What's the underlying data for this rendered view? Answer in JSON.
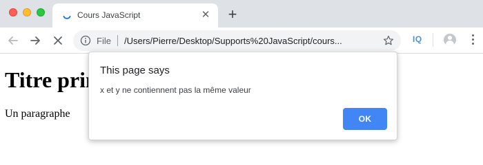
{
  "browser": {
    "tab": {
      "title": "Cours JavaScript",
      "close_glyph": "✕",
      "spinner_icon": "loading-spinner-icon"
    },
    "new_tab_glyph": "+",
    "toolbar": {
      "back_icon": "arrow-left-icon",
      "forward_icon": "arrow-right-icon",
      "stop_icon": "stop-loading-icon",
      "omnibox": {
        "scheme_label": "File",
        "url": "/Users/Pierre/Desktop/Supports%20JavaScript/cours...",
        "info_icon": "info-icon",
        "bookmark_icon": "star-icon"
      },
      "extension_label": "IQ",
      "extension_color": "#4a90d9"
    }
  },
  "page": {
    "heading": "Titre principal",
    "paragraph": "Un paragraphe"
  },
  "dialog": {
    "title": "This page says",
    "message": "x et y ne contiennent pas la même valeur",
    "ok_label": "OK",
    "ok_color": "#4285f4"
  },
  "colors": {
    "tabstrip_bg": "#dee1e6",
    "traffic_close": "#fe5f57",
    "traffic_minimize": "#febc2e",
    "traffic_maximize": "#28c840"
  }
}
